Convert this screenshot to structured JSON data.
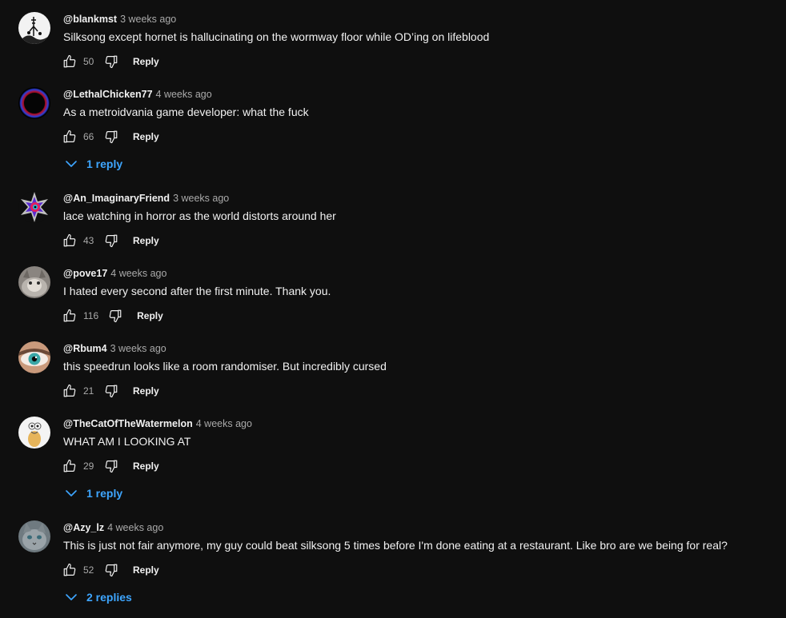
{
  "colors": {
    "background": "#0f0f0f",
    "text": "#f1f1f1",
    "secondary_text": "#aaaaaa",
    "link_blue": "#3ea6ff"
  },
  "icons": {
    "like": "thumbs-up-icon",
    "dislike": "thumbs-down-icon",
    "expand": "chevron-down-icon"
  },
  "reply_label": "Reply",
  "comments": [
    {
      "author": "@blankmst",
      "time": "3 weeks ago",
      "text": "Silksong except hornet is hallucinating on the wormway floor while OD’ing on lifeblood",
      "likes": "50",
      "replies": null
    },
    {
      "author": "@LethalChicken77",
      "time": "4 weeks ago",
      "text": "As a metroidvania game developer: what the fuck",
      "likes": "66",
      "replies": "1 reply"
    },
    {
      "author": "@An_ImaginaryFriend",
      "time": "3 weeks ago",
      "text": "lace watching in horror as the world distorts around her",
      "likes": "43",
      "replies": null
    },
    {
      "author": "@pove17",
      "time": "4 weeks ago",
      "text": "I hated every second after the first minute. Thank you.",
      "likes": "116",
      "replies": null
    },
    {
      "author": "@Rbum4",
      "time": "3 weeks ago",
      "text": "this speedrun looks like a room randomiser. But incredibly cursed",
      "likes": "21",
      "replies": null
    },
    {
      "author": "@TheCatOfTheWatermelon",
      "time": "4 weeks ago",
      "text": "WHAT AM I LOOKING AT",
      "likes": "29",
      "replies": "1 reply"
    },
    {
      "author": "@Azy_lz",
      "time": "4 weeks ago",
      "text": "This is just not fair anymore, my guy could beat silksong 5 times before I'm done eating at a restaurant. Like bro are we being for real?",
      "likes": "52",
      "replies": "2 replies"
    }
  ]
}
